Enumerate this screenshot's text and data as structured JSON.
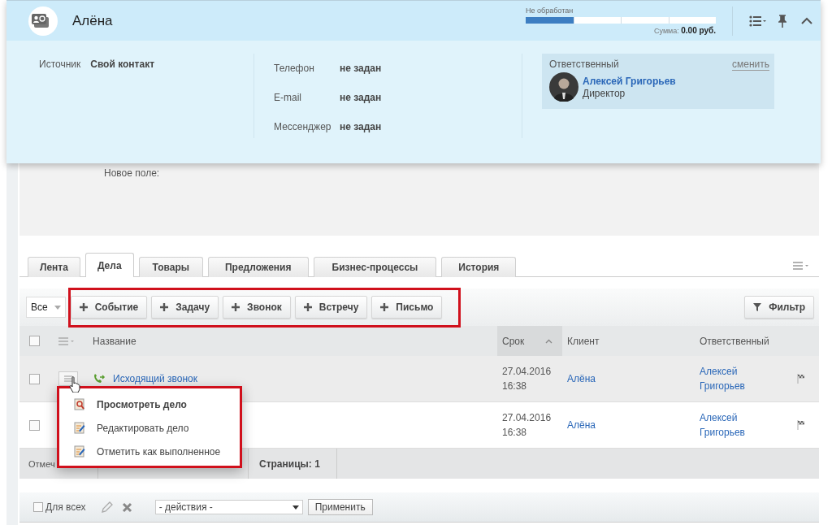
{
  "header": {
    "title": "Алёна",
    "status_label": "Не обработан",
    "status": {
      "level": 0.25
    },
    "sum_label": "Сумма:",
    "sum_value": "0.00 руб."
  },
  "details": {
    "source_label": "Источник",
    "source_value": "Свой контакт",
    "contacts": [
      {
        "label": "Телефон",
        "value": "не задан"
      },
      {
        "label": "E-mail",
        "value": "не задан"
      },
      {
        "label": "Мессенджер",
        "value": "не задан"
      }
    ],
    "responsible": {
      "heading": "Ответственный",
      "change_link": "сменить",
      "name": "Алексей Григорьев",
      "position": "Директор"
    }
  },
  "new_field_label": "Новое поле:",
  "tabs": [
    {
      "label": "Лента",
      "selected": false
    },
    {
      "label": "Дела",
      "selected": true
    },
    {
      "label": "Товары",
      "selected": false
    },
    {
      "label": "Предложения",
      "selected": false
    },
    {
      "label": "Бизнес-процессы",
      "selected": false
    },
    {
      "label": "История",
      "selected": false
    }
  ],
  "toolbar": {
    "filter_select": "Все",
    "add_buttons_highlighted": true,
    "add_buttons": [
      "Событие",
      "Задачу",
      "Звонок",
      "Встречу",
      "Письмо"
    ],
    "filter_button": "Фильтр"
  },
  "table": {
    "all_checked": false,
    "columns": [
      {
        "label": "Название",
        "sorted": false
      },
      {
        "label": "Срок",
        "sorted": true
      },
      {
        "label": "Клиент",
        "sorted": false
      },
      {
        "label": "Ответственный",
        "sorted": false
      }
    ],
    "rows": [
      {
        "kind": "call",
        "title": "Исходящий звонок",
        "deadline_date": "27.04.2016",
        "deadline_time": "16:38",
        "client": "Алёна",
        "responsible": "Алексей Григорьев",
        "hovered": true,
        "checked": false
      },
      {
        "kind": "hidden",
        "deadline_date": "27.04.2016",
        "deadline_time": "16:38",
        "client": "Алёна",
        "responsible": "Алексей Григорьев",
        "hovered": false,
        "checked": false
      }
    ]
  },
  "context_menu": {
    "highlighted": true,
    "items": [
      {
        "kind": "view",
        "label": "Просмотреть дело",
        "default": true
      },
      {
        "kind": "edit",
        "label": "Редактировать дело",
        "default": false
      },
      {
        "kind": "edit",
        "label": "Отметить как выполненное",
        "default": false
      }
    ]
  },
  "footer": {
    "selected_label": "Отмеч",
    "pages": "Страницы: 1"
  },
  "actions_bar": {
    "for_all_label": "Для всех",
    "for_all_checked": false,
    "action_select": "- действия -",
    "apply_button": "Применить"
  }
}
